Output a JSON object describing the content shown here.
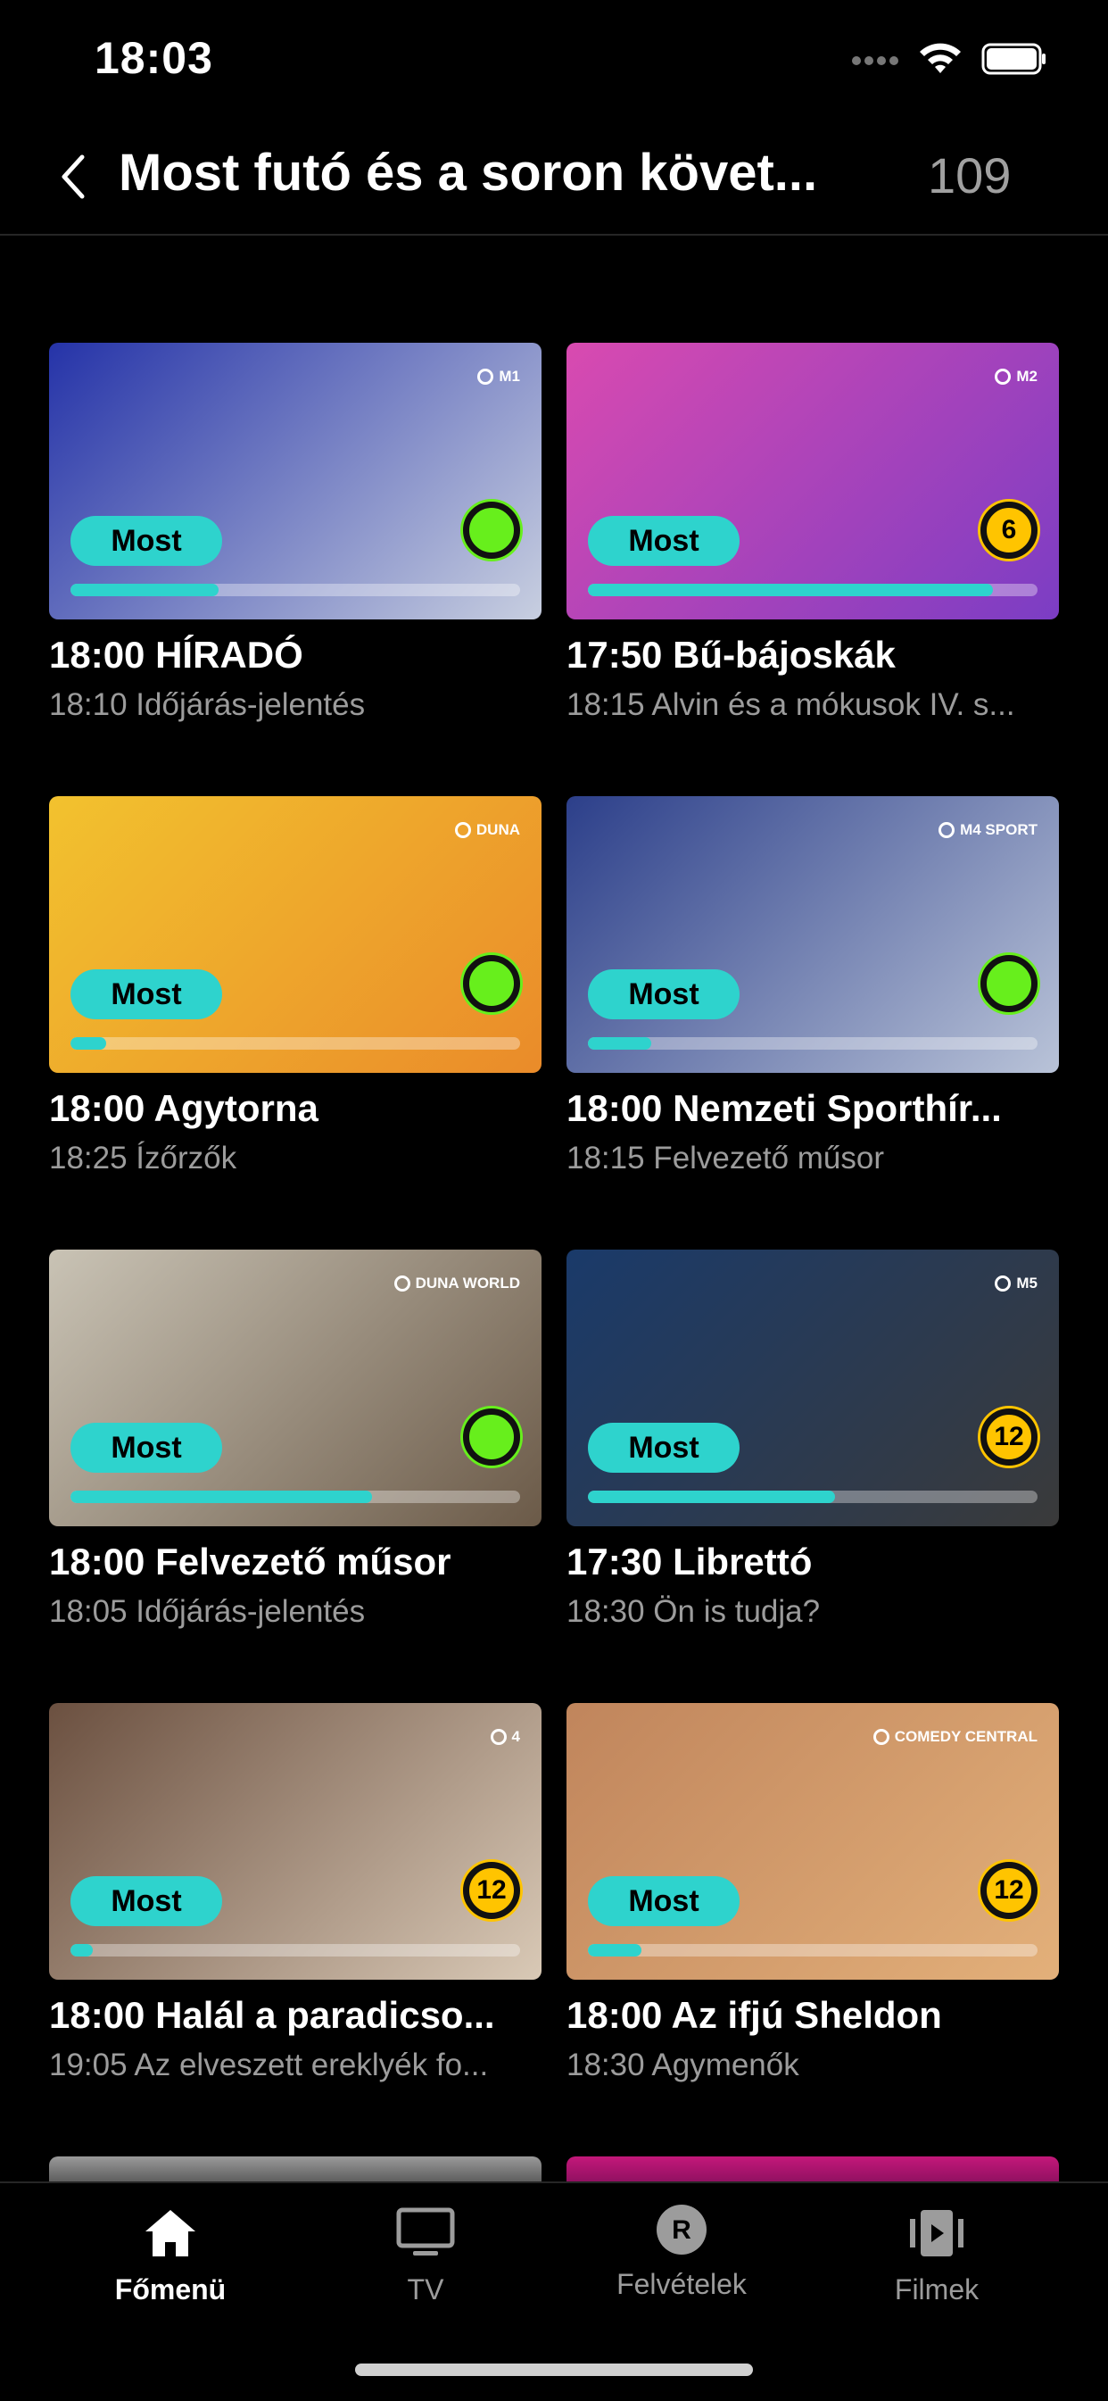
{
  "status": {
    "time": "18:03"
  },
  "header": {
    "title": "Most futó és a soron követ...",
    "count": "109"
  },
  "cards": [
    {
      "title": "18:00 HÍRADÓ",
      "next": "18:10 Időjárás-jelentés",
      "badge": "Most",
      "channel": "M1",
      "rating": "",
      "rating_color": "green",
      "progress": 0.33,
      "thumb_colors": [
        "#2533a8",
        "#c8cfe0"
      ]
    },
    {
      "title": "17:50 Bű-bájoskák",
      "next": "18:15 Alvin és a mókusok IV. s...",
      "badge": "Most",
      "channel": "M2",
      "rating": "6",
      "rating_color": "yellow",
      "progress": 0.9,
      "thumb_colors": [
        "#d94ab0",
        "#7b3dc4"
      ]
    },
    {
      "title": "18:00 Agytorna",
      "next": "18:25 Ízőrzők",
      "badge": "Most",
      "channel": "DUNA",
      "rating": "",
      "rating_color": "green",
      "progress": 0.08,
      "thumb_colors": [
        "#f2c22e",
        "#ea8b2a"
      ]
    },
    {
      "title": "18:00 Nemzeti Sporthír...",
      "next": "18:15 Felvezető műsor",
      "badge": "Most",
      "channel": "M4 SPORT",
      "rating": "",
      "rating_color": "green",
      "progress": 0.14,
      "thumb_colors": [
        "#2c3f8a",
        "#b9c3d8"
      ]
    },
    {
      "title": "18:00 Felvezető műsor",
      "next": "18:05 Időjárás-jelentés",
      "badge": "Most",
      "channel": "DUNA WORLD",
      "rating": "",
      "rating_color": "green",
      "progress": 0.67,
      "thumb_colors": [
        "#c9c3b5",
        "#6b5a48"
      ]
    },
    {
      "title": "17:30 Librettó",
      "next": "18:30 Ön is tudja?",
      "badge": "Most",
      "channel": "M5",
      "rating": "12",
      "rating_color": "yellow",
      "progress": 0.55,
      "thumb_colors": [
        "#1a3a6a",
        "#3a3a3a"
      ]
    },
    {
      "title": "18:00 Halál a paradicso...",
      "next": "19:05 Az elveszett ereklyék fo...",
      "badge": "Most",
      "channel": "4",
      "rating": "12",
      "rating_color": "yellow",
      "progress": 0.05,
      "thumb_colors": [
        "#6b5040",
        "#d9c9b6"
      ]
    },
    {
      "title": "18:00 Az ifjú Sheldon",
      "next": "18:30 Agymenők",
      "badge": "Most",
      "channel": "COMEDY CENTRAL",
      "rating": "12",
      "rating_color": "yellow",
      "progress": 0.12,
      "thumb_colors": [
        "#c0855c",
        "#e3b07a"
      ]
    }
  ],
  "tabs": [
    {
      "label": "Főmenü",
      "icon": "home-icon",
      "active": true
    },
    {
      "label": "TV",
      "icon": "tv-icon",
      "active": false
    },
    {
      "label": "Felvételek",
      "icon": "recordings-icon",
      "active": false
    },
    {
      "label": "Filmek",
      "icon": "movies-icon",
      "active": false
    }
  ],
  "colors": {
    "accent": "#2ed3cd",
    "rating_green": "#67ef1c",
    "rating_yellow": "#ffc400"
  }
}
